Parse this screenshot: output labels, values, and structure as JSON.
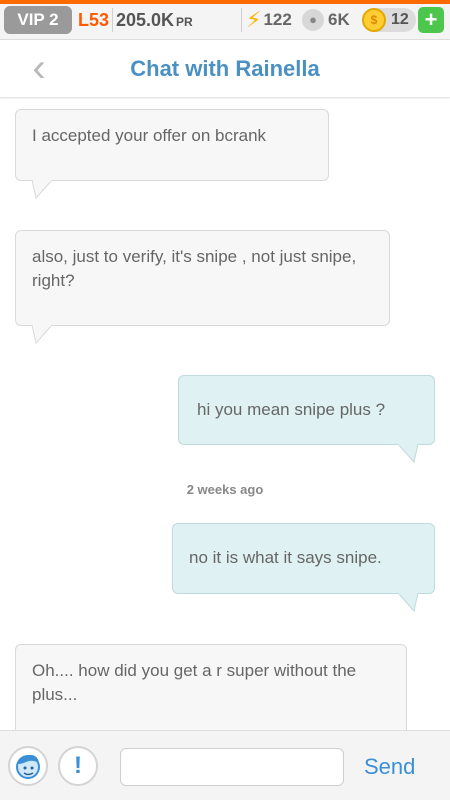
{
  "status_bar": {
    "vip": "VIP 2",
    "level": "L53",
    "pr_value": "205.0K",
    "pr_unit": "PR",
    "energy": "122",
    "paw": "6K",
    "coins": "12",
    "plus": "+"
  },
  "header": {
    "back_icon": "‹",
    "title": "Chat with Rainella"
  },
  "messages": [
    {
      "side": "left",
      "text": "I accepted your offer on bcrank"
    },
    {
      "side": "left",
      "text": "also, just to verify, it's snipe , not just snipe, right?"
    },
    {
      "side": "right",
      "text": "hi you mean snipe plus ?"
    },
    {
      "type": "timestamp",
      "text": "2 weeks ago"
    },
    {
      "side": "right",
      "text": "no it is what it says snipe."
    },
    {
      "side": "left",
      "text": "Oh.... how did you get a r super without the plus..."
    }
  ],
  "input_bar": {
    "message_value": "",
    "message_placeholder": "",
    "send_label": "Send",
    "alert_label": "!"
  },
  "colors": {
    "accent": "#ff6a00",
    "title_blue": "#4a90c2",
    "right_bubble": "#dff1f2",
    "left_bubble": "#f7f7f7"
  }
}
